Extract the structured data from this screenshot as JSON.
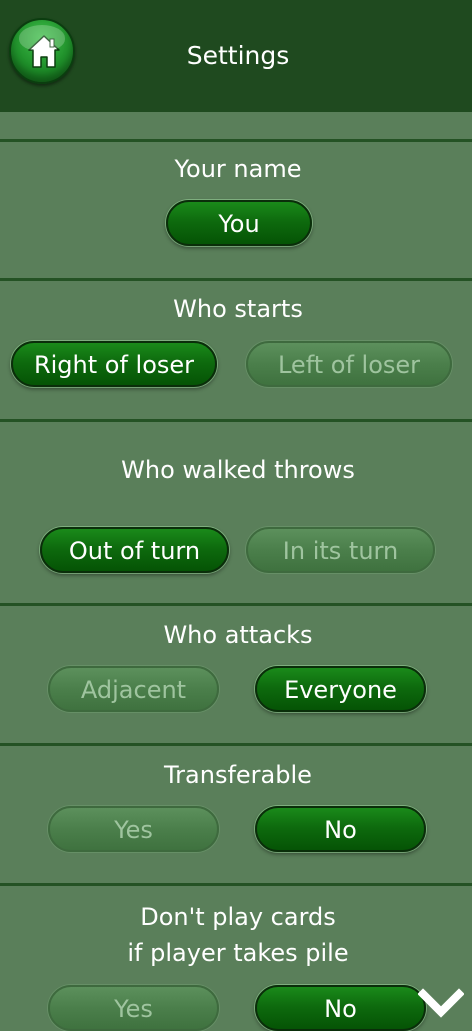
{
  "header": {
    "title": "Settings",
    "home_icon": "home-icon"
  },
  "sections": [
    {
      "title": "Your name",
      "options": [
        {
          "label": "You",
          "selected": true
        }
      ]
    },
    {
      "title": "Who starts",
      "options": [
        {
          "label": "Right of loser",
          "selected": true
        },
        {
          "label": "Left of loser",
          "selected": false
        }
      ]
    },
    {
      "title": "Who walked throws",
      "options": [
        {
          "label": "Out of turn",
          "selected": true
        },
        {
          "label": "In its turn",
          "selected": false
        }
      ]
    },
    {
      "title": "Who attacks",
      "options": [
        {
          "label": "Adjacent",
          "selected": false
        },
        {
          "label": "Everyone",
          "selected": true
        }
      ]
    },
    {
      "title": "Transferable",
      "options": [
        {
          "label": "Yes",
          "selected": false
        },
        {
          "label": "No",
          "selected": true
        }
      ]
    },
    {
      "title_line1": "Don't play cards",
      "title_line2": "if player takes pile",
      "options": [
        {
          "label": "Yes",
          "selected": false
        },
        {
          "label": "No",
          "selected": true
        }
      ]
    }
  ],
  "scroll_indicator": {
    "icon": "chevron-down-icon"
  },
  "colors": {
    "background": "#5a7f5a",
    "header": "#1f4a1f",
    "selected_button": "#0e6b0e",
    "unselected_button": "#4b7f4b",
    "unselected_text": "#9fc49f"
  }
}
